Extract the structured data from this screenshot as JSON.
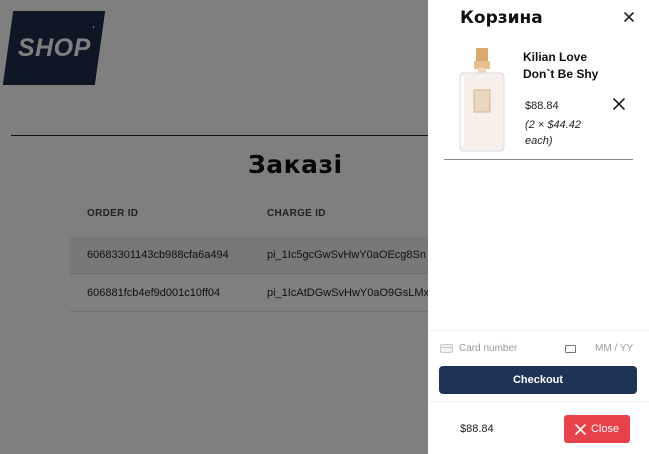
{
  "background_page": {
    "logo_text": "SHOP",
    "logo_mark": "'",
    "page_title": "Заказі",
    "table": {
      "headers": [
        "ORDER ID",
        "CHARGE ID"
      ],
      "rows": [
        [
          "60683301143cb988cfa6a494",
          "pi_1Ic5gcGwSvHwY0aOEcg8Sn"
        ],
        [
          "606881fcb4ef9d001c10ff04",
          "pi_1IcAtDGwSvHwY0aO9GsLMx"
        ]
      ]
    }
  },
  "cart": {
    "title": "Корзина",
    "close_icon": "close-icon",
    "items": [
      {
        "name": "Kilian Love Don`t Be Shy",
        "price": "$88.84",
        "each": "(2 × $44.42 each)",
        "image": "perfume-bottle"
      }
    ],
    "payment": {
      "card_placeholder": "Card number",
      "expiry_placeholder": "MM / YY",
      "checkout_label": "Checkout"
    },
    "total": "$88.84",
    "close_label": "Close"
  },
  "colors": {
    "brand_navy": "#1e2f4d",
    "checkout_button": "#1e3456",
    "close_button": "#e8414a",
    "overlay": "rgba(0,0,0,0.5)"
  }
}
